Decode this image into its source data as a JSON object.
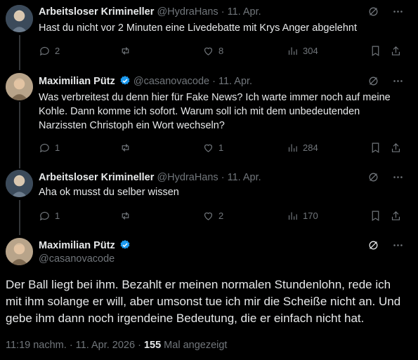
{
  "tweets": [
    {
      "name": "Arbeitsloser Krimineller",
      "handle": "@HydraHans",
      "sep": " · ",
      "date": "11. Apr.",
      "text": "Hast du nicht vor 2 Minuten eine Livedebatte mit Krys Anger abgelehnt",
      "replies": "2",
      "reposts": "",
      "likes": "8",
      "views": "304"
    },
    {
      "name": "Maximilian Pütz",
      "handle": "@casanovacode",
      "sep": " · ",
      "date": "11. Apr.",
      "text": "Was verbreitest du denn hier für Fake News? Ich warte immer noch auf meine Kohle. Dann komme ich sofort. Warum soll ich mit dem unbedeutenden Narzissten Christoph ein Wort wechseln?",
      "replies": "1",
      "reposts": "",
      "likes": "1",
      "views": "284"
    },
    {
      "name": "Arbeitsloser Krimineller",
      "handle": "@HydraHans",
      "sep": " · ",
      "date": "11. Apr.",
      "text": "Aha ok musst du selber wissen",
      "replies": "1",
      "reposts": "",
      "likes": "2",
      "views": "170"
    }
  ],
  "main": {
    "name": "Maximilian Pütz",
    "handle": "@casanovacode",
    "text": "Der Ball liegt bei ihm. Bezahlt er meinen normalen Stundenlohn, rede ich mit ihm solange er will, aber umsonst tue ich mir die Scheiße nicht an. Und gebe ihm dann noch irgendeine Bedeutung, die er einfach nicht hat.",
    "time": "11:19 nachm. · 11. Apr. 2026 · ",
    "views_count": "155",
    "views_label": " Mal angezeigt"
  },
  "icons": {
    "grok": "grok-icon",
    "more": "more-icon",
    "reply": "reply-icon",
    "repost": "repost-icon",
    "like": "like-icon",
    "views": "views-icon",
    "bookmark": "bookmark-icon",
    "share": "share-icon",
    "verified": "verified-badge-icon"
  },
  "colors": {
    "background": "#000000",
    "text": "#e7e9ea",
    "muted": "#71767b",
    "verified": "#1d9bf0"
  }
}
